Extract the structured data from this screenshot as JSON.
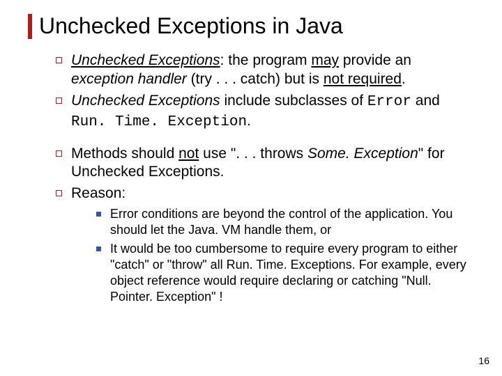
{
  "title": "Unchecked Exceptions in Java",
  "bullets1": {
    "b1": {
      "part1": "Unchecked Exceptions",
      "part2": ":  the program ",
      "part3": "may",
      "part4": " provide an ",
      "part5": "exception handler",
      "part6": " (try . . . catch) but is ",
      "part7": "not required",
      "part8": "."
    },
    "b2": {
      "part1": "Unchecked Exceptions",
      "part2": " include subclasses of ",
      "part3": "Error",
      "part4": " and ",
      "part5": "Run. Time. Exception",
      "part6": "."
    }
  },
  "bullets2": {
    "b3": {
      "part1": "Methods should ",
      "part2": "not",
      "part3": " use \". . . throws ",
      "part4": "Some. Exception",
      "part5": "\" for Unchecked Exceptions."
    },
    "b4": "Reason:"
  },
  "subbullets": {
    "s1": "Error conditions are beyond the control of the application. You should let the Java. VM handle them, or",
    "s2": "It would be too cumbersome to require every program to either \"catch\" or \"throw\" all Run. Time. Exceptions.  For example, every object reference would require declaring or catching \"Null. Pointer. Exception\" !"
  },
  "slide_number": "16"
}
